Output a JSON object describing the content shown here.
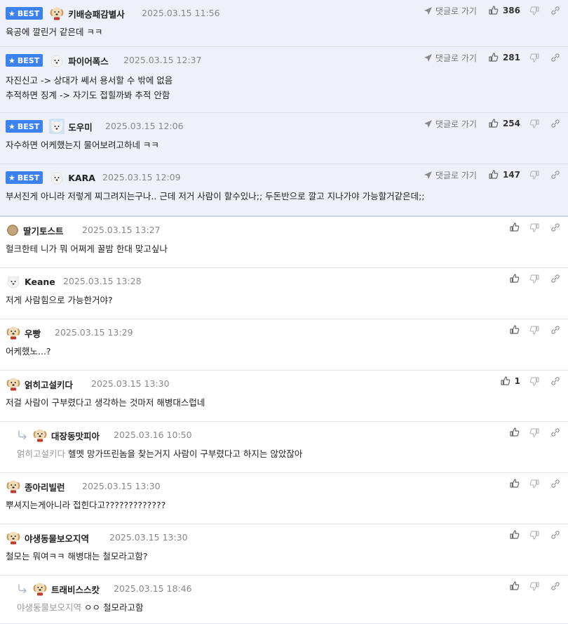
{
  "best_label": "BEST",
  "goto_label": "댓글로 가기",
  "comments": [
    {
      "nick": "키배승패감별사",
      "date": "2025.03.15 11:56",
      "text": [
        "육공에 깔린거 같은데 ㅋㅋ"
      ],
      "likes": "386",
      "best": true,
      "avatar": "retriever-puppy"
    },
    {
      "nick": "파이어폭스",
      "date": "2025.03.15 12:37",
      "text": [
        "자진신고 -> 상대가 쎄서 용서할 수 밖에 없음",
        "추적하면 징계 -> 자기도 접힐까봐 추적 안함"
      ],
      "likes": "281",
      "best": true,
      "avatar": "white-dog"
    },
    {
      "nick": "도우미",
      "date": "2025.03.15 12:06",
      "text": [
        "자수하면 어케했는지 물어보려고하네 ㅋㅋ"
      ],
      "likes": "254",
      "best": true,
      "avatar": "white-dog-blue"
    },
    {
      "nick": "KARA",
      "date": "2025.03.15 12:09",
      "text": [
        "부서진게 아니라 저렇게 찌그려지는구나.. 근데 저거 사람이 할수있나;; 두돈반으로 깔고 지나가야 가능할거같은데;;"
      ],
      "likes": "147",
      "best": true,
      "avatar": "white-dog"
    },
    {
      "nick": "딸기토스트",
      "date": "2025.03.15 13:27",
      "text": [
        "헐크한테 니가 뭐 어쩌게 꿀밤 한대 맞고싶나"
      ],
      "likes": "",
      "avatar": "toast"
    },
    {
      "nick": "Keane",
      "date": "2025.03.15 13:28",
      "text": [
        "저게 사람힘으로 가능한거야?"
      ],
      "likes": "",
      "avatar": "white-dog"
    },
    {
      "nick": "우빵",
      "date": "2025.03.15 13:29",
      "text": [
        "어케했노...?"
      ],
      "likes": "",
      "avatar": "retriever-puppy"
    },
    {
      "nick": "얽히고설키다",
      "date": "2025.03.15 13:30",
      "text": [
        "저걸 사람이 구부렸다고 생각하는 것마저 해병대스럽네"
      ],
      "likes": "1",
      "avatar": "retriever-puppy"
    },
    {
      "nick": "대장동맛피아",
      "date": "2025.03.16 10:50",
      "mention": "얽히고설키다",
      "text": [
        "헬멧 망가뜨린놈을 찾는거지 사람이 구부렸다고 하지는 않았잖아"
      ],
      "likes": "",
      "reply": true,
      "avatar": "retriever-puppy"
    },
    {
      "nick": "종아리빌런",
      "date": "2025.03.15 13:30",
      "text": [
        "뿌셔지는게아니라 접힌다고?????????????"
      ],
      "likes": "",
      "avatar": "retriever-puppy"
    },
    {
      "nick": "야생동물보오지역",
      "date": "2025.03.15 13:30",
      "text": [
        "철모는 뭐여ㅋㅋ 해병대는 철모라고함?"
      ],
      "likes": "",
      "avatar": "retriever-puppy"
    },
    {
      "nick": "트래비스스캇",
      "date": "2025.03.15 18:46",
      "mention": "야생동물보오지역",
      "text": [
        "ㅇㅇ 철모라고함"
      ],
      "likes": "",
      "reply": true,
      "avatar": "retriever-puppy"
    }
  ]
}
